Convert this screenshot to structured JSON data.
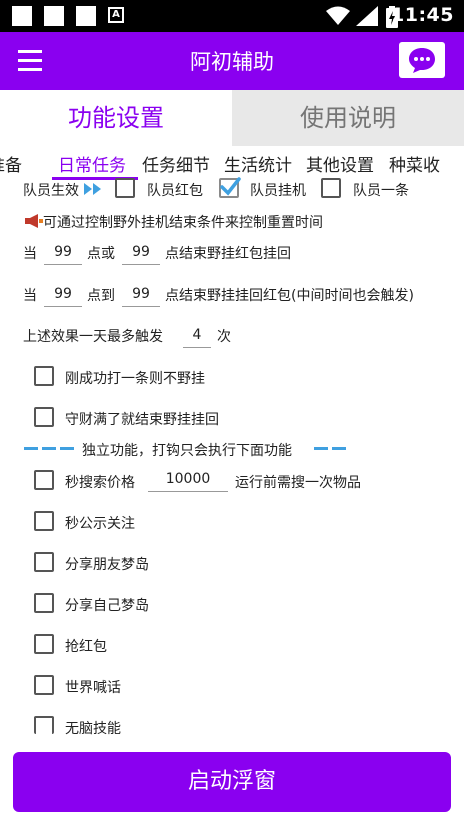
{
  "status_bar": {
    "time": "11:45",
    "notification_badge": "A"
  },
  "app_bar": {
    "title": "阿初辅助"
  },
  "main_tabs": [
    {
      "label": "功能设置",
      "active": true
    },
    {
      "label": "使用说明",
      "active": false
    }
  ],
  "sub_tabs": [
    {
      "label": "准备"
    },
    {
      "label": "日常任务",
      "active": true
    },
    {
      "label": "任务细节"
    },
    {
      "label": "生活统计"
    },
    {
      "label": "其他设置"
    },
    {
      "label": "种菜收"
    }
  ],
  "team": {
    "label": "队员生效",
    "options": [
      {
        "label": "队员红包",
        "checked": false
      },
      {
        "label": "队员挂机",
        "checked": true
      },
      {
        "label": "队员一条",
        "checked": false
      }
    ]
  },
  "notice": "可通过控制野外挂机结束条件来控制重置时间",
  "cond1": {
    "prefix": "当",
    "value1": "99",
    "mid": "点或",
    "value2": "99",
    "suffix": "点结束野挂红包挂回"
  },
  "cond2": {
    "prefix": "当",
    "value1": "99",
    "mid": "点到",
    "value2": "99",
    "suffix": "点结束野挂挂回红包(中间时间也会触发)"
  },
  "trigger": {
    "prefix": "上述效果一天最多触发",
    "value": "4",
    "suffix": "次"
  },
  "options": [
    {
      "label": "刚成功打一条则不野挂",
      "checked": false
    },
    {
      "label": "守财满了就结束野挂挂回",
      "checked": false
    }
  ],
  "divider_text": "独立功能，打钩只会执行下面功能",
  "search": {
    "label": "秒搜索价格",
    "value": "10000",
    "suffix": "运行前需搜一次物品",
    "checked": false
  },
  "independent": [
    {
      "label": "秒公示关注",
      "checked": false
    },
    {
      "label": "分享朋友梦岛",
      "checked": false
    },
    {
      "label": "分享自己梦岛",
      "checked": false
    },
    {
      "label": "抢红包",
      "checked": false
    },
    {
      "label": "世界喊话",
      "checked": false
    },
    {
      "label": "无脑技能",
      "checked": false
    }
  ],
  "start_button": "启动浮窗",
  "colors": {
    "primary": "#8a00f0",
    "accent_blue": "#3fa0e0"
  }
}
